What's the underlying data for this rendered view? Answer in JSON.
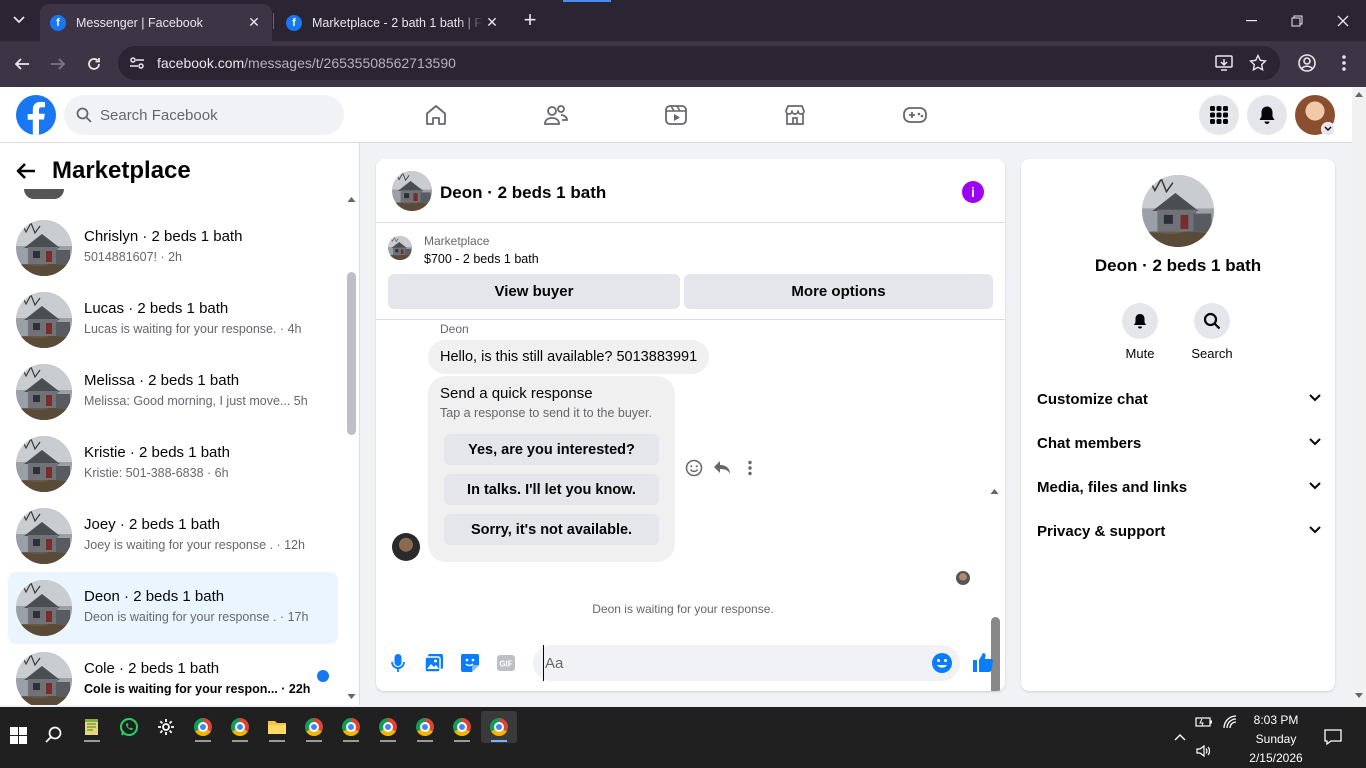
{
  "browser": {
    "tabs": [
      {
        "title": "Messenger | Facebook",
        "active": true
      },
      {
        "title": "Marketplace - 2 bath 1 bath | Fa",
        "active": false
      }
    ],
    "url_domain": "facebook.com",
    "url_path": "/messages/t/26535508562713590"
  },
  "fb": {
    "search_placeholder": "Search Facebook"
  },
  "left": {
    "title": "Marketplace",
    "conversations": [
      {
        "name": "Chrislyn · 2 beds 1 bath",
        "snippet": "5014881607! · 2h",
        "selected": false,
        "unread": false
      },
      {
        "name": "Lucas · 2 beds 1 bath",
        "snippet": "Lucas is waiting for your response. · 4h",
        "selected": false,
        "unread": false
      },
      {
        "name": "Melissa · 2 beds 1 bath",
        "snippet": "Melissa: Good morning, I just move...  5h",
        "selected": false,
        "unread": false
      },
      {
        "name": "Kristie · 2 beds 1 bath",
        "snippet": "Kristie: 501-388-6838 · 6h",
        "selected": false,
        "unread": false
      },
      {
        "name": "Joey · 2 beds 1 bath",
        "snippet": "Joey is waiting for your response . · 12h",
        "selected": false,
        "unread": false
      },
      {
        "name": "Deon · 2 beds 1 bath",
        "snippet": "Deon is waiting for your response . · 17h",
        "selected": true,
        "unread": false
      },
      {
        "name": "Cole · 2 beds 1 bath",
        "snippet": "Cole is waiting for your respon... · 22h",
        "selected": false,
        "unread": true
      }
    ]
  },
  "chat": {
    "title": "Deon · 2 beds 1 bath",
    "listing_source": "Marketplace",
    "listing_price": "$700 - 2 beds 1 bath",
    "view_buyer": "View buyer",
    "more_options": "More options",
    "sender_name": "Deon",
    "message": "Hello, is this still available? 5013883991",
    "quick_title": "Send a quick response",
    "quick_sub": "Tap a response to send it to the buyer.",
    "quick_responses": [
      "Yes, are you interested?",
      "In talks. I'll let you know.",
      "Sorry, it's not available."
    ],
    "waiting": "Deon is waiting for your response.",
    "composer_placeholder": "Aa",
    "gif_label": "GIF"
  },
  "info": {
    "name": "Deon · 2 beds 1 bath",
    "mute": "Mute",
    "search": "Search",
    "sections": [
      "Customize chat",
      "Chat members",
      "Media, files and links",
      "Privacy & support"
    ]
  },
  "taskbar": {
    "time": "8:03 PM",
    "day": "Sunday",
    "date": "2/15/2026"
  },
  "colors": {
    "brand": "#1877f2",
    "info_purple": "#9b00f7",
    "selected_row": "#ebf5ff"
  }
}
